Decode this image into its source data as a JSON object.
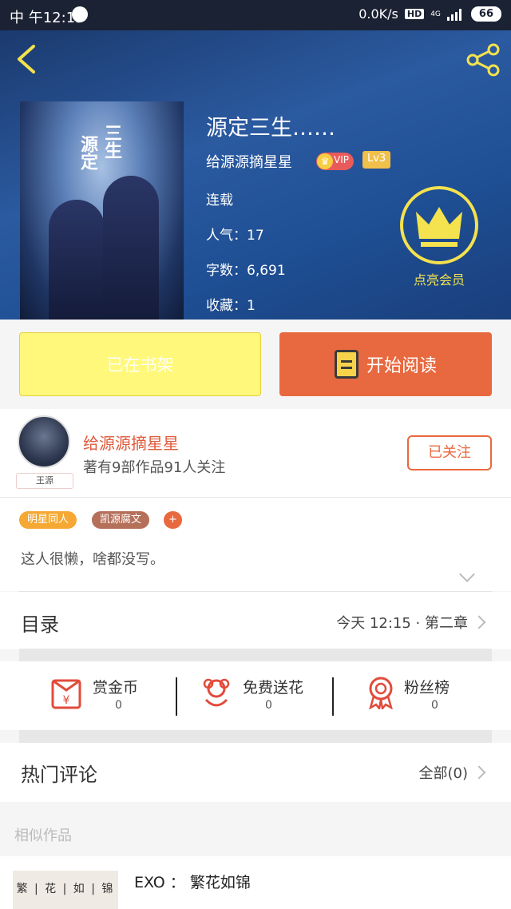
{
  "status_bar": {
    "carrier": "中 午12:15",
    "speed": "0.0K/s",
    "hd": "HD",
    "signal": "4G",
    "battery": "66"
  },
  "book": {
    "title": "源定三生……",
    "author": "给源源摘星星",
    "vip": "VIP",
    "level": "Lv3",
    "status": "连载",
    "popularity": "人气：17",
    "words": "字数：6,691",
    "favorites": "收藏：1",
    "cover_text_1": "源定",
    "cover_text_2": "三生"
  },
  "member": {
    "label": "点亮会员"
  },
  "actions": {
    "shelf": "已在书架",
    "read": "开始阅读"
  },
  "author_card": {
    "name": "给源源摘星星",
    "stats": "著有9部作品91人关注",
    "avatar_tag": "王源",
    "follow": "已关注"
  },
  "tags": [
    {
      "label": "明星同人",
      "color": "#f5a833"
    },
    {
      "label": "凯源腐文",
      "color": "#b5705a"
    },
    {
      "label": "+",
      "color": "#e8693f"
    }
  ],
  "description": "这人很懒，啥都没写。",
  "catalog": {
    "title": "目录",
    "latest": "今天 12:15 · 第二章"
  },
  "stats_row": [
    {
      "label": "赏金币",
      "value": "0",
      "icon": "reward-coin-icon"
    },
    {
      "label": "免费送花",
      "value": "0",
      "icon": "flower-icon"
    },
    {
      "label": "粉丝榜",
      "value": "0",
      "icon": "medal-icon"
    }
  ],
  "comments": {
    "title": "热门评论",
    "all": "全部(0)"
  },
  "similar": {
    "title": "相似作品",
    "cover_text": "繁 | 花 | 如 | 锦",
    "book_title": "EXO ： 繁花如锦"
  }
}
